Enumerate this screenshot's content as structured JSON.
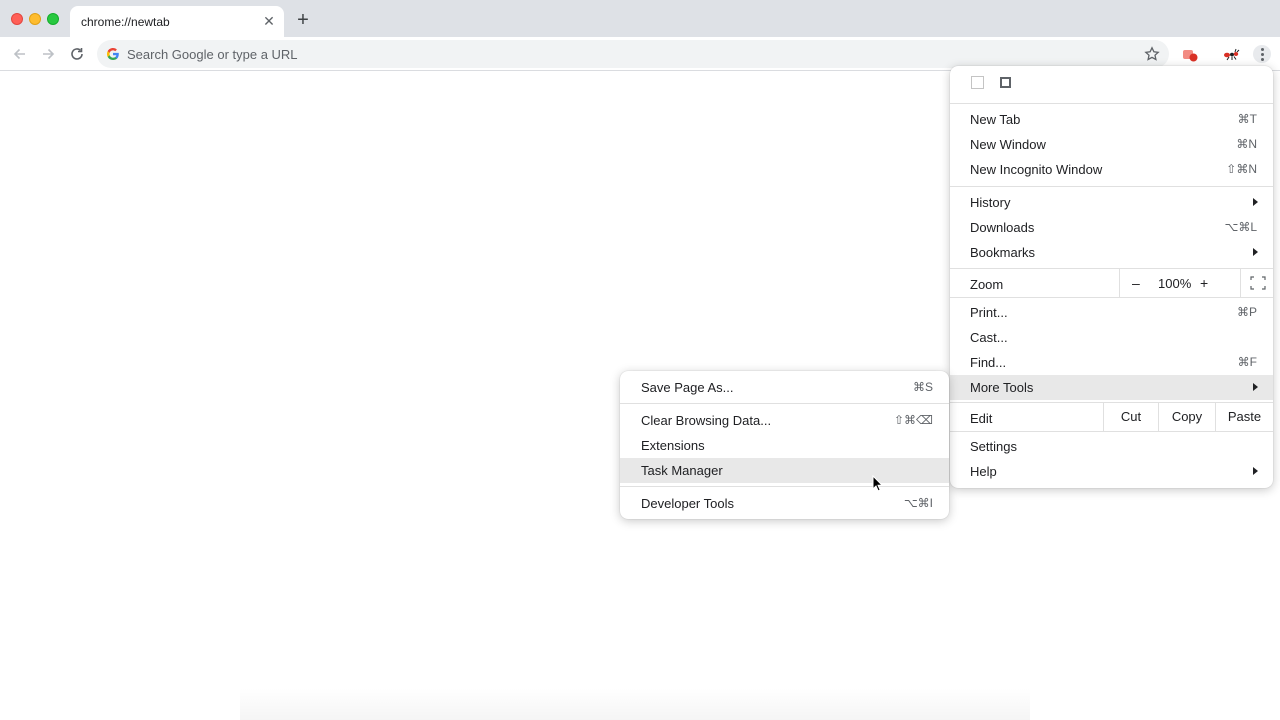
{
  "tab": {
    "title": "chrome://newtab",
    "close_glyph": "✕",
    "new_tab_glyph": "+"
  },
  "omnibox": {
    "placeholder": "Search Google or type a URL"
  },
  "main_menu": {
    "items": [
      {
        "label": "New Tab",
        "shortcut": "⌘T"
      },
      {
        "label": "New Window",
        "shortcut": "⌘N"
      },
      {
        "label": "New Incognito Window",
        "shortcut": "⇧⌘N"
      },
      {
        "label": "History",
        "shortcut": ""
      },
      {
        "label": "Downloads",
        "shortcut": "⌥⌘L"
      },
      {
        "label": "Bookmarks",
        "shortcut": ""
      },
      {
        "label": "Print...",
        "shortcut": "⌘P"
      },
      {
        "label": "Cast...",
        "shortcut": ""
      },
      {
        "label": "Find...",
        "shortcut": "⌘F"
      },
      {
        "label": "More Tools",
        "shortcut": ""
      },
      {
        "label": "Settings",
        "shortcut": ""
      },
      {
        "label": "Help",
        "shortcut": ""
      }
    ],
    "zoom": {
      "label": "Zoom",
      "minus": "–",
      "value": "100%",
      "plus": "+"
    },
    "edit": {
      "label": "Edit",
      "cut": "Cut",
      "copy": "Copy",
      "paste": "Paste"
    }
  },
  "more_tools_menu": {
    "items": [
      {
        "label": "Save Page As...",
        "shortcut": "⌘S"
      },
      {
        "label": "Clear Browsing Data...",
        "shortcut": "⇧⌘⌫"
      },
      {
        "label": "Extensions",
        "shortcut": ""
      },
      {
        "label": "Task Manager",
        "shortcut": ""
      },
      {
        "label": "Developer Tools",
        "shortcut": "⌥⌘I"
      }
    ]
  },
  "colors": {
    "tabstrip": "#dee1e6",
    "highlight": "#e8e8e8",
    "omnibox": "#f1f3f4"
  }
}
